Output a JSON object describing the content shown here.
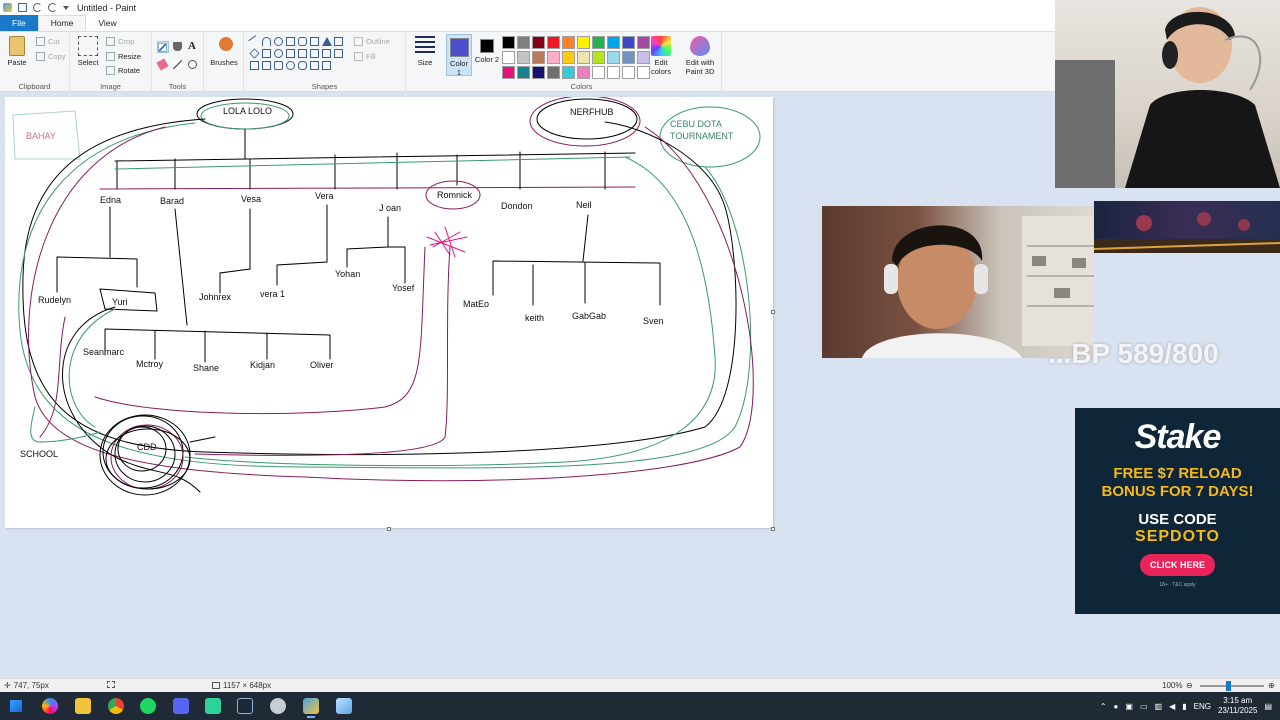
{
  "window": {
    "title": "Untitled - Paint"
  },
  "tabs": [
    "File",
    "Home",
    "View"
  ],
  "ribbon": {
    "clipboard": {
      "paste": "Paste",
      "cut": "Cut",
      "copy": "Copy",
      "label": "Clipboard"
    },
    "image": {
      "select": "Select",
      "crop": "Crop",
      "resize": "Resize",
      "rotate": "Rotate",
      "label": "Image"
    },
    "tools": {
      "label": "Tools"
    },
    "brushes": {
      "label": "Brushes"
    },
    "shapes": {
      "outline": "Outline",
      "fill": "Fill",
      "label": "Shapes"
    },
    "size": {
      "label": "Size"
    },
    "colors": {
      "color1": "Color 1",
      "color2": "Color 2",
      "color1_value": "#4a4fcf",
      "color2_value": "#000000",
      "edit_colors": "Edit colors",
      "edit_paint3d": "Edit with Paint 3D",
      "label": "Colors",
      "palette": [
        "#000000",
        "#7f7f7f",
        "#880015",
        "#ed1c24",
        "#ff7f27",
        "#fff200",
        "#22b14c",
        "#00a2e8",
        "#3f48cc",
        "#a349a4",
        "#ffffff",
        "#c3c3c3",
        "#b97a57",
        "#ffaec9",
        "#ffc90e",
        "#efe4b0",
        "#b5e61d",
        "#99d9ea",
        "#7092be",
        "#c8bfe7",
        "#e8127f",
        "#1a7f8f",
        "#14146e",
        "#6f6f6f",
        "#36c9d8",
        "#ea7fc0",
        "#ffffff",
        "#ffffff",
        "#ffffff",
        "#ffffff"
      ]
    }
  },
  "canvas": {
    "labels": {
      "bahay": "BAHAY",
      "lola_lolo": "LOLA LOLO",
      "nerfhub": "NERFHUB",
      "cebu_dota": "CEBU DOTA",
      "tournament": "TOURNAMENT",
      "edna": "Edna",
      "barad": "Barad",
      "vesa": "Vesa",
      "vera": "Vera",
      "joan": "J oan",
      "romnick": "Romnick",
      "dondon": "Dondon",
      "neil": "Neil",
      "rudelyn": "Rudelyn",
      "yuri": "Yuri",
      "johnrex": "Johnrex",
      "vera1": "vera 1",
      "yohan": "Yohan",
      "yosef": "Yosef",
      "mateo": "MatEo",
      "keith": "keith",
      "gabgab": "GabGab",
      "sven": "Sven",
      "seanmarc": "Seanmarc",
      "mctroy": "Mctroy",
      "shane": "Shane",
      "kidjan": "Kidjan",
      "oliver": "Oliver",
      "cdd": "CDD",
      "school": "SCHOOL"
    }
  },
  "overlays": {
    "stream_text": "...BP 589/800",
    "stake": {
      "logo": "Stake",
      "promo_line1": "FREE $7 RELOAD",
      "promo_line2": "BONUS FOR 7 DAYS!",
      "use_code": "USE CODE",
      "code": "SEPDOTO",
      "cta": "CLICK HERE",
      "fine": "18+ · T&C apply"
    }
  },
  "statusbar": {
    "cursor_pos": "747, 75px",
    "canvas_size": "1157 × 648px",
    "zoom": "100%",
    "zoom_fraction": 0.44
  },
  "taskbar": {
    "lang": "ENG",
    "time": "3:15 am",
    "date": "23/11/2025"
  }
}
